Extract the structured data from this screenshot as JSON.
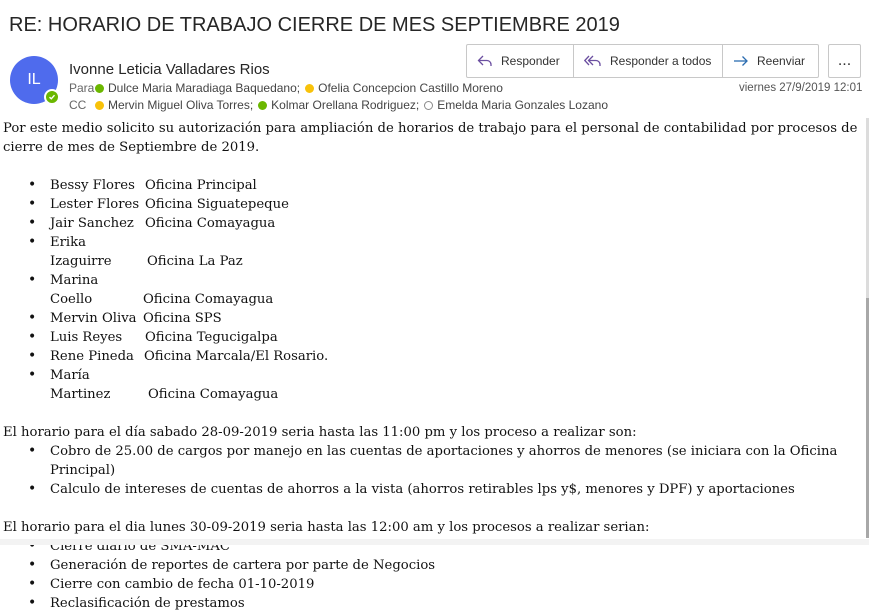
{
  "subject": "RE: HORARIO DE TRABAJO CIERRE DE MES SEPTIEMBRE 2019",
  "sender": {
    "initials": "IL",
    "name": "Ivonne Leticia Valladares Rios",
    "avatar_color": "#4f6bed",
    "presence": "available"
  },
  "to": {
    "label": "Para",
    "recipients": [
      {
        "name": "Dulce Maria Maradiaga Baquedano;",
        "status": "green"
      },
      {
        "name": "Ofelia Concepcion Castillo Moreno",
        "status": "yellow"
      }
    ]
  },
  "cc": {
    "label": "CC",
    "recipients": [
      {
        "name": "Mervin Miguel Oliva Torres;",
        "status": "yellow"
      },
      {
        "name": "Kolmar Orellana Rodriguez;",
        "status": "green"
      },
      {
        "name": "Emelda Maria Gonzales Lozano",
        "status": "empty"
      }
    ]
  },
  "actions": {
    "reply": "Responder",
    "reply_all": "Responder a todos",
    "forward": "Reenviar",
    "more": "..."
  },
  "datetime": "viernes 27/9/2019 12:01",
  "body": {
    "intro": "Por este medio solicito su autorización para ampliación de horarios de trabajo para el personal de contabilidad por procesos de cierre de mes de Septiembre de 2019.",
    "staff": [
      {
        "name": "Bessy Flores",
        "office": "Oficina Principal"
      },
      {
        "name": "Lester Flores",
        "office": "Oficina Siguatepeque"
      },
      {
        "name": "Jair Sanchez",
        "office": "Oficina Comayagua"
      },
      {
        "name": "Erika Izaguirre",
        "office": "Oficina La Paz"
      },
      {
        "name": "Marina Coello",
        "office": "Oficina Comayagua"
      },
      {
        "name": "Mervin Oliva",
        "office": "Oficina SPS"
      },
      {
        "name": "Luis Reyes",
        "office": "Oficina Tegucigalpa"
      },
      {
        "name": "Rene Pineda",
        "office": "Oficina Marcala/El Rosario."
      },
      {
        "name": "María Martinez",
        "office": "Oficina Comayagua"
      }
    ],
    "saturday_heading": "El horario para el día sabado 28-09-2019 seria hasta las 11:00 pm y los proceso a realizar son:",
    "saturday_tasks": [
      "Cobro de 25.00 de cargos por manejo en las cuentas de aportaciones y ahorros de menores (se iniciara con la Oficina Principal)",
      "Calculo de intereses de cuentas de ahorros a la vista (ahorros retirables lps y$, menores y DPF) y aportaciones"
    ],
    "monday_heading": "El horario para el dia lunes 30-09-2019 seria hasta las 12:00 am y los procesos a realizar serian:",
    "monday_tasks": [
      "Cierre diario de SMA-MAC",
      "Generación de reportes de cartera por parte de Negocios",
      "Cierre con cambio de fecha 01-10-2019",
      "Reclasificación de prestamos"
    ]
  }
}
